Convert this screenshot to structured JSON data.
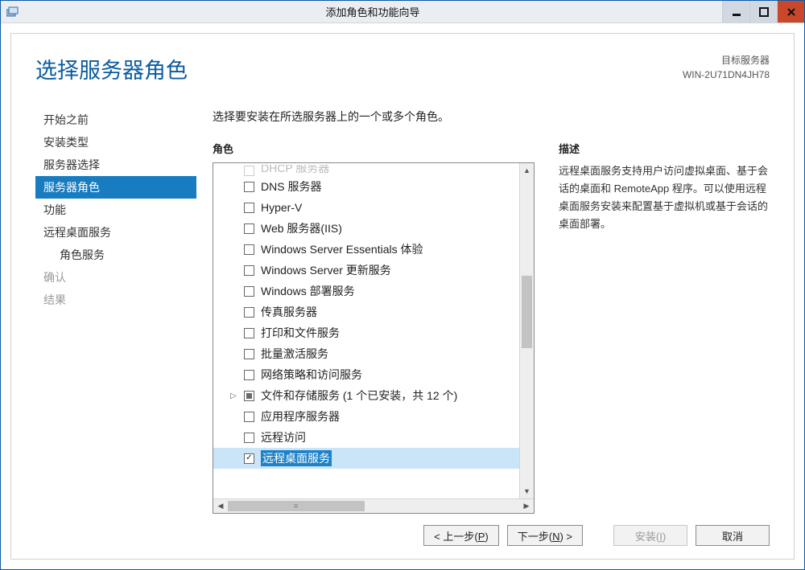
{
  "window": {
    "title": "添加角色和功能向导"
  },
  "header": {
    "page_title": "选择服务器角色",
    "target_label": "目标服务器",
    "target_name": "WIN-2U71DN4JH78"
  },
  "nav": {
    "items": [
      {
        "label": "开始之前",
        "active": false,
        "disabled": false,
        "sub": false
      },
      {
        "label": "安装类型",
        "active": false,
        "disabled": false,
        "sub": false
      },
      {
        "label": "服务器选择",
        "active": false,
        "disabled": false,
        "sub": false
      },
      {
        "label": "服务器角色",
        "active": true,
        "disabled": false,
        "sub": false
      },
      {
        "label": "功能",
        "active": false,
        "disabled": false,
        "sub": false
      },
      {
        "label": "远程桌面服务",
        "active": false,
        "disabled": false,
        "sub": false
      },
      {
        "label": "角色服务",
        "active": false,
        "disabled": false,
        "sub": true
      },
      {
        "label": "确认",
        "active": false,
        "disabled": true,
        "sub": false
      },
      {
        "label": "结果",
        "active": false,
        "disabled": true,
        "sub": false
      }
    ]
  },
  "main": {
    "instruction": "选择要安装在所选服务器上的一个或多个角色。",
    "roles_label": "角色",
    "roles": [
      {
        "label": "DHCP 服务器",
        "state": "none",
        "cutoff": true
      },
      {
        "label": "DNS 服务器",
        "state": "none"
      },
      {
        "label": "Hyper-V",
        "state": "none"
      },
      {
        "label": "Web 服务器(IIS)",
        "state": "none"
      },
      {
        "label": "Windows Server Essentials 体验",
        "state": "none"
      },
      {
        "label": "Windows Server 更新服务",
        "state": "none"
      },
      {
        "label": "Windows 部署服务",
        "state": "none"
      },
      {
        "label": "传真服务器",
        "state": "none"
      },
      {
        "label": "打印和文件服务",
        "state": "none"
      },
      {
        "label": "批量激活服务",
        "state": "none"
      },
      {
        "label": "网络策略和访问服务",
        "state": "none"
      },
      {
        "label": "文件和存储服务 (1 个已安装，共 12 个)",
        "state": "partial",
        "expandable": true
      },
      {
        "label": "应用程序服务器",
        "state": "none"
      },
      {
        "label": "远程访问",
        "state": "none"
      },
      {
        "label": "远程桌面服务",
        "state": "checked",
        "selected": true
      }
    ],
    "desc_label": "描述",
    "desc_text": "远程桌面服务支持用户访问虚拟桌面、基于会话的桌面和 RemoteApp 程序。可以使用远程桌面服务安装来配置基于虚拟机或基于会话的桌面部署。"
  },
  "footer": {
    "prev": "< 上一步(P)",
    "next": "下一步(N) >",
    "install": "安装(I)",
    "cancel": "取消"
  }
}
